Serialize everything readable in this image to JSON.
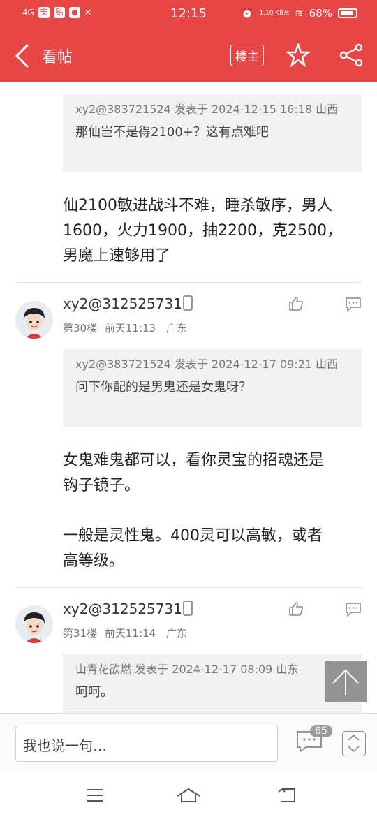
{
  "status": {
    "network": "4G",
    "time": "12:15",
    "speed": "1.10 KB/s",
    "battery": "68%"
  },
  "header": {
    "title": "看帖",
    "owner_label": "楼主"
  },
  "quote1": {
    "meta": "xy2@383721524 发表于 2024-12-15 16:18 山西",
    "text": "那仙岂不是得2100+？这有点难吧"
  },
  "body1": {
    "line1": "仙2100敏进战斗不难，睡杀敏序，男人",
    "line2": "1600，火力1900，抽2200，克2500，",
    "line3": "男魔上速够用了"
  },
  "post30": {
    "username": "xy2@312525731",
    "floor": "第30楼",
    "time": "前天11:13",
    "region": "广东",
    "quote_meta": "xy2@383721524 发表于 2024-12-17 09:21 山西",
    "quote_text": "问下你配的是男鬼还是女鬼呀？",
    "line1": "女鬼难鬼都可以，看你灵宝的招魂还是",
    "line2": "钩子镜子。",
    "line3": "一般是灵性鬼。400灵可以高敏，或者",
    "line4": "高等级。"
  },
  "post31": {
    "username": "xy2@312525731",
    "floor": "第31楼",
    "time": "前天11:14",
    "region": "广东",
    "quote_meta": "山青花欲燃 发表于 2024-12-17 08:09 山东",
    "quote_text": "呵呵。"
  },
  "bottom": {
    "placeholder": "我也说一句…",
    "comment_count": "65"
  },
  "colors": {
    "brand": "#e84545",
    "quote_bg": "#f1f1f1"
  }
}
